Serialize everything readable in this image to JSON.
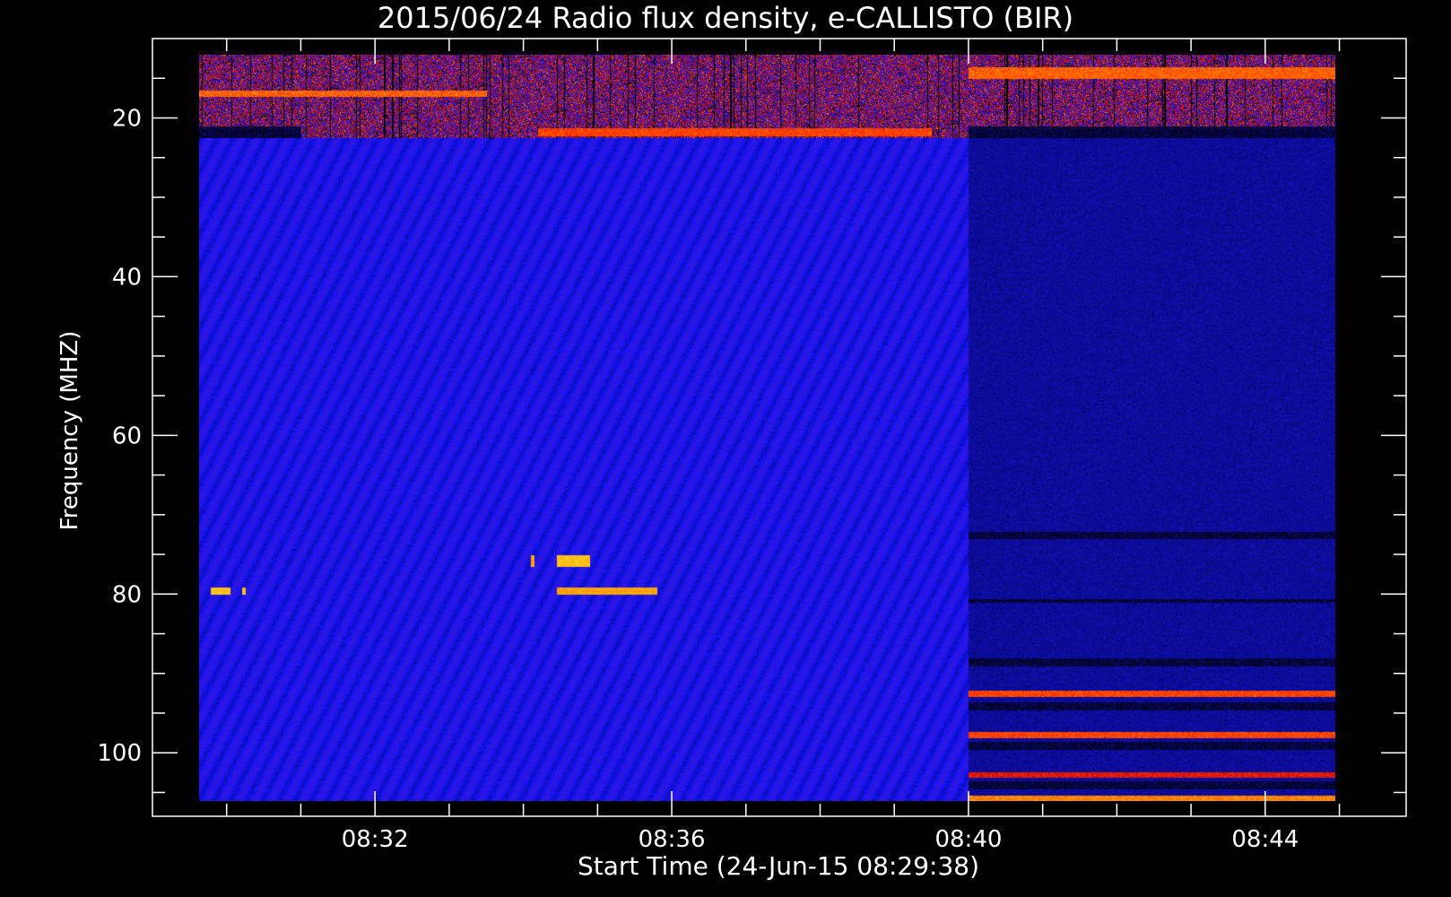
{
  "chart_data": {
    "type": "heatmap",
    "title": "2015/06/24  Radio flux density, e-CALLISTO (BIR)",
    "xlabel": "Start Time (24-Jun-15 08:29:38)",
    "ylabel": "Frequency (MHZ)",
    "x_ticks": [
      {
        "value": 32,
        "label": "08:32"
      },
      {
        "value": 36,
        "label": "08:36"
      },
      {
        "value": 40,
        "label": "08:40"
      },
      {
        "value": 44,
        "label": "08:44"
      }
    ],
    "y_ticks": [
      {
        "value": 20,
        "label": "20"
      },
      {
        "value": 40,
        "label": "40"
      },
      {
        "value": 60,
        "label": "60"
      },
      {
        "value": 80,
        "label": "80"
      },
      {
        "value": 100,
        "label": "100"
      }
    ],
    "xlim": [
      29.0,
      45.9
    ],
    "ylim": [
      10,
      108
    ],
    "data_extent": {
      "x": [
        29.63,
        44.95
      ],
      "y": [
        12,
        106
      ]
    },
    "colormap": [
      "#000000",
      "#1414ff",
      "#5a1aa8",
      "#b0000a",
      "#ff2a00",
      "#ff9a00",
      "#ffff40"
    ],
    "background_level": 0.18,
    "features": [
      {
        "kind": "interference_band",
        "x": [
          29.63,
          44.95
        ],
        "y": [
          12,
          22.5
        ],
        "level": 0.55
      },
      {
        "kind": "dark_band",
        "x": [
          29.63,
          31.0
        ],
        "y": [
          21.0,
          22.5
        ],
        "level": 0.0
      },
      {
        "kind": "dark_band",
        "x": [
          40.0,
          44.95
        ],
        "y": [
          21.0,
          22.5
        ],
        "level": 0.0
      },
      {
        "kind": "hot_band",
        "x": [
          29.63,
          33.5
        ],
        "y": [
          16.5,
          17.3
        ],
        "level": 0.75
      },
      {
        "kind": "hot_band",
        "x": [
          34.2,
          39.5
        ],
        "y": [
          21.2,
          22.2
        ],
        "level": 0.7
      },
      {
        "kind": "hot_band",
        "x": [
          40.0,
          44.95
        ],
        "y": [
          13.5,
          15.0
        ],
        "level": 0.75
      },
      {
        "kind": "burst",
        "x": [
          29.78,
          30.05
        ],
        "y": [
          79.0,
          80.0
        ],
        "level": 0.9
      },
      {
        "kind": "burst",
        "x": [
          30.2,
          30.25
        ],
        "y": [
          79.0,
          80.0
        ],
        "level": 0.9
      },
      {
        "kind": "burst",
        "x": [
          34.1,
          34.15
        ],
        "y": [
          75.0,
          76.5
        ],
        "level": 0.85
      },
      {
        "kind": "burst",
        "x": [
          34.45,
          34.9
        ],
        "y": [
          75.0,
          76.5
        ],
        "level": 0.9
      },
      {
        "kind": "burst",
        "x": [
          34.45,
          35.8
        ],
        "y": [
          79.0,
          80.0
        ],
        "level": 0.85
      },
      {
        "kind": "receiver_change",
        "x": [
          40.0,
          44.95
        ],
        "y": [
          22.5,
          106
        ],
        "level": 0.1
      },
      {
        "kind": "dark_band",
        "x": [
          40.0,
          44.95
        ],
        "y": [
          72.0,
          73.0
        ],
        "level": 0.0
      },
      {
        "kind": "dark_band",
        "x": [
          40.0,
          44.95
        ],
        "y": [
          80.5,
          81.0
        ],
        "level": 0.0
      },
      {
        "kind": "dark_band",
        "x": [
          40.0,
          44.95
        ],
        "y": [
          88.0,
          89.0
        ],
        "level": 0.0
      },
      {
        "kind": "hot_band",
        "x": [
          40.0,
          44.95
        ],
        "y": [
          92.0,
          92.8
        ],
        "level": 0.7
      },
      {
        "kind": "dark_band",
        "x": [
          40.0,
          44.95
        ],
        "y": [
          93.5,
          94.5
        ],
        "level": 0.0
      },
      {
        "kind": "hot_band",
        "x": [
          40.0,
          44.95
        ],
        "y": [
          97.3,
          98.0
        ],
        "level": 0.7
      },
      {
        "kind": "dark_band",
        "x": [
          40.0,
          44.95
        ],
        "y": [
          98.5,
          99.5
        ],
        "level": 0.0
      },
      {
        "kind": "hot_band",
        "x": [
          40.0,
          44.95
        ],
        "y": [
          102.3,
          103.0
        ],
        "level": 0.6
      },
      {
        "kind": "dark_band",
        "x": [
          40.0,
          44.95
        ],
        "y": [
          103.5,
          104.5
        ],
        "level": 0.0
      },
      {
        "kind": "hot_band",
        "x": [
          40.0,
          44.95
        ],
        "y": [
          105.3,
          106.0
        ],
        "level": 0.8
      }
    ],
    "grid": false,
    "legend": "none"
  }
}
